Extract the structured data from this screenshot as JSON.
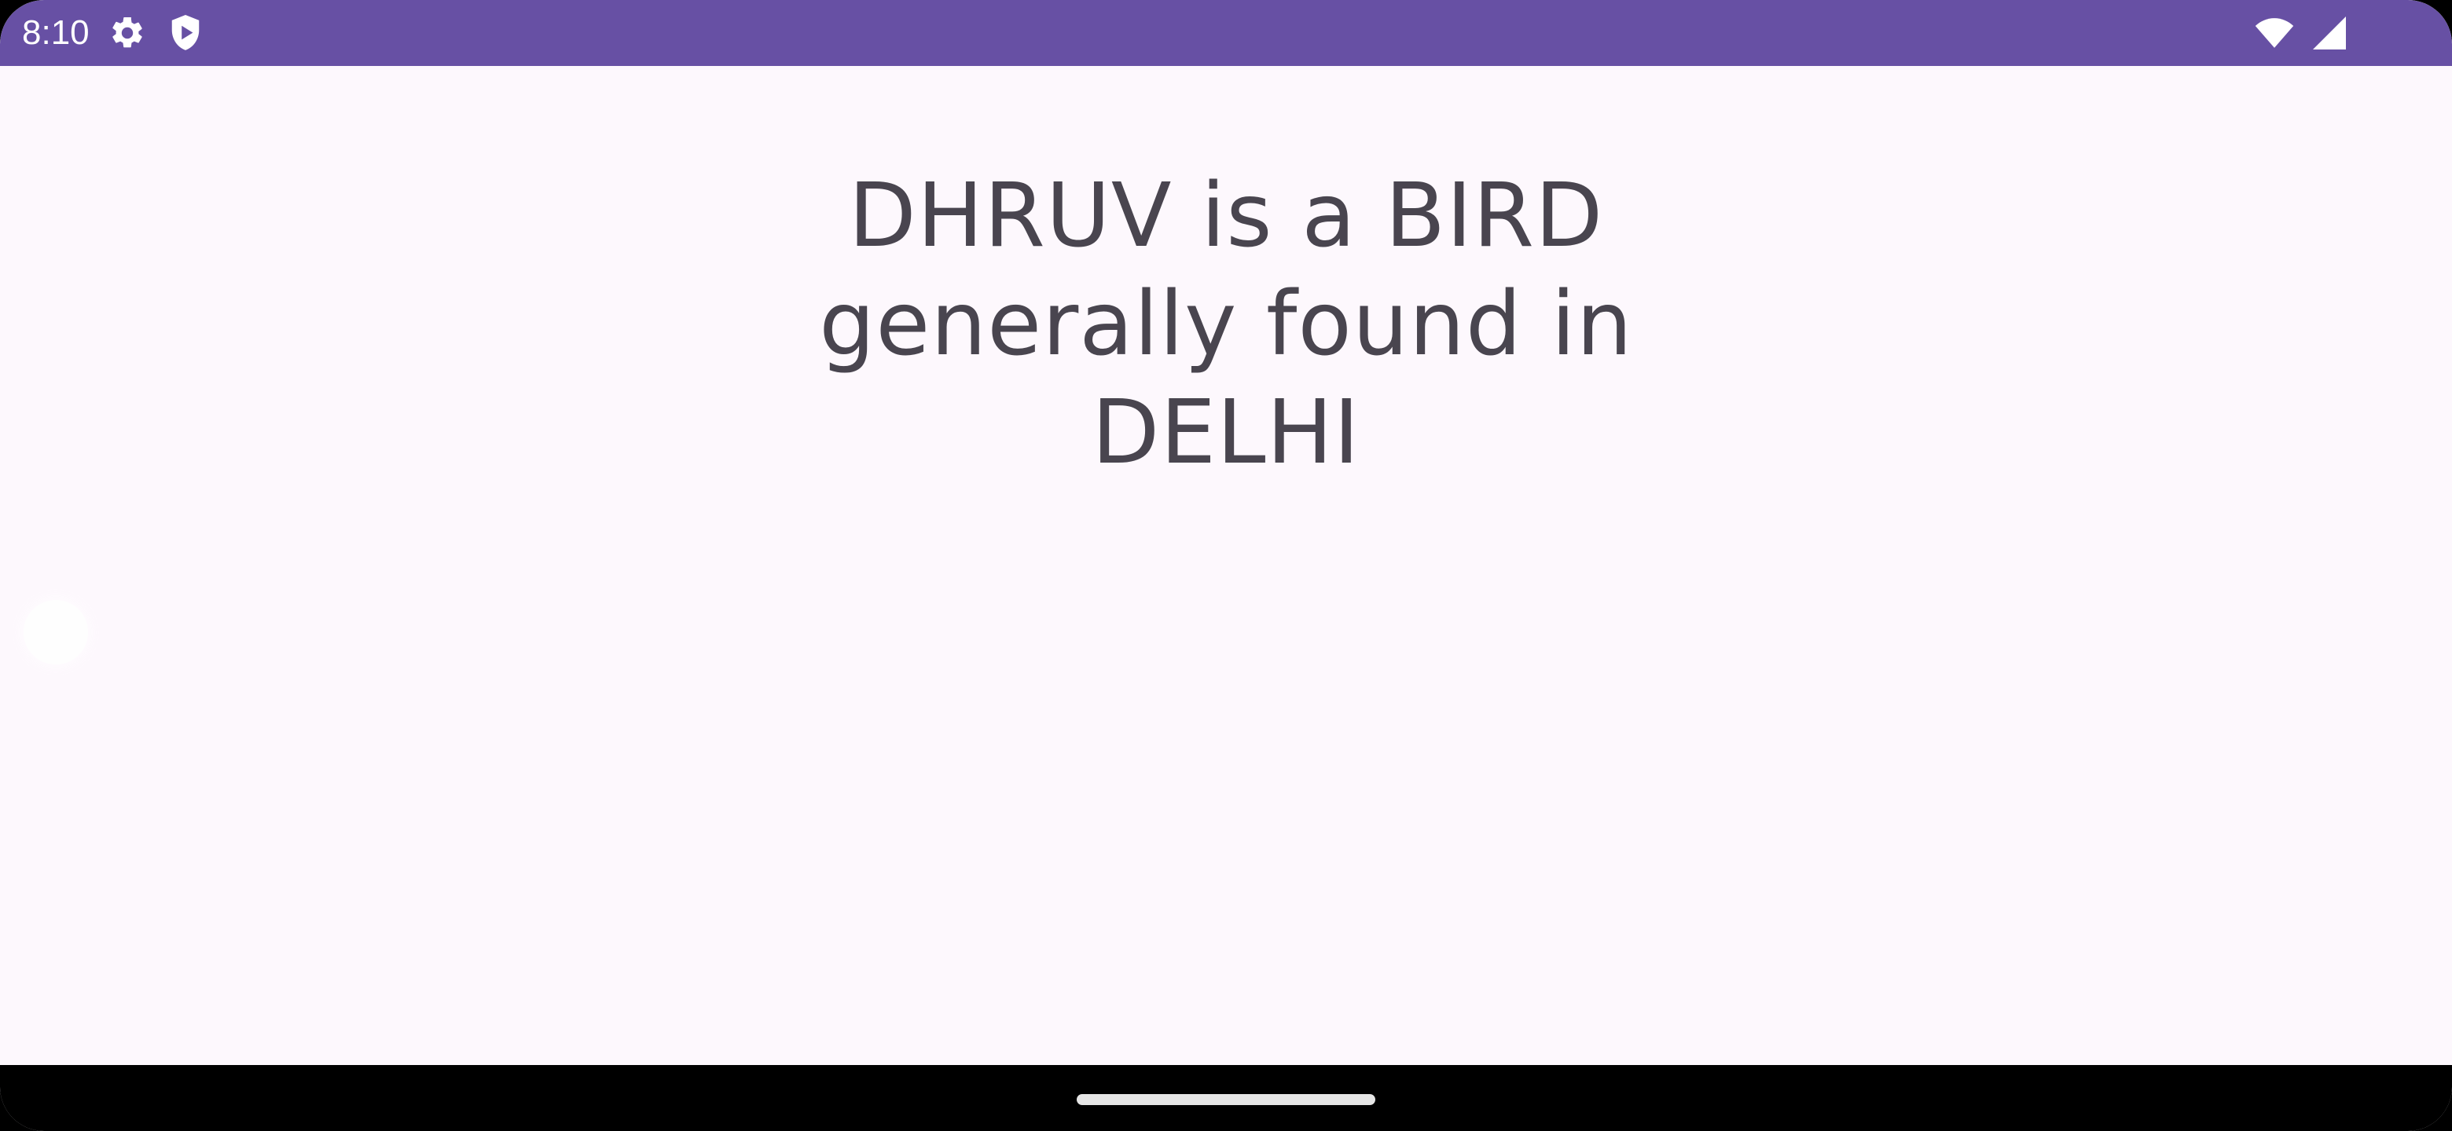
{
  "status_bar": {
    "time": "8:10",
    "left_icons": [
      "settings-gear-icon",
      "play-protect-shield-icon"
    ],
    "right_icons": [
      "wifi-icon",
      "cellular-signal-icon"
    ],
    "background_color": "#6750a4"
  },
  "main": {
    "message_lines": [
      "DHRUV is a BIRD",
      "generally found in",
      "DELHI"
    ],
    "text_color": "#49454f",
    "background_color": "#fdf8fd"
  },
  "navigation": {
    "type": "gesture",
    "background_color": "#000000"
  }
}
